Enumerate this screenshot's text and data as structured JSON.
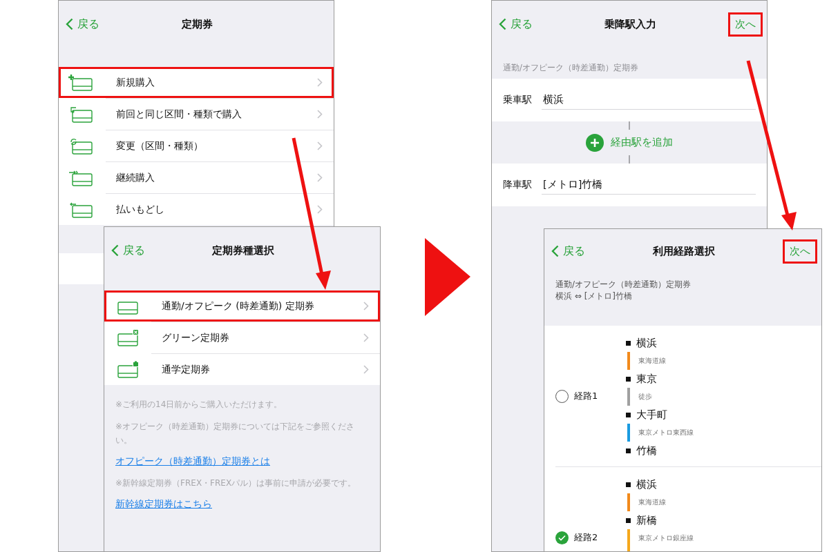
{
  "screen_1": {
    "back": "戻る",
    "title": "定期券",
    "items": [
      {
        "label": "新規購入",
        "highlighted": true
      },
      {
        "label": "前回と同じ区間・種類で購入",
        "highlighted": false
      },
      {
        "label": "変更（区間・種類）",
        "highlighted": false
      },
      {
        "label": "継続購入",
        "highlighted": false
      },
      {
        "label": "払いもどし",
        "highlighted": false
      }
    ]
  },
  "screen_2": {
    "back": "戻る",
    "title": "定期券種選択",
    "items": [
      {
        "label": "通勤/オフピーク (時差通勤) 定期券",
        "highlighted": true
      },
      {
        "label": "グリーン定期券",
        "highlighted": false
      },
      {
        "label": "通学定期券",
        "highlighted": false
      }
    ],
    "notes": [
      {
        "kind": "note",
        "text": "※ご利用の14日前からご購入いただけます。"
      },
      {
        "kind": "note",
        "text": "※オフピーク（時差通勤）定期券については下記をご参照ください。"
      },
      {
        "kind": "link",
        "text": "オフピーク（時差通勤）定期券とは"
      },
      {
        "kind": "note",
        "text": "※新幹線定期券（FREX・FREXパル）は事前に申請が必要です。"
      },
      {
        "kind": "link",
        "text": "新幹線定期券はこちら"
      }
    ]
  },
  "screen_3": {
    "back": "戻る",
    "title": "乗降駅入力",
    "next": {
      "label": "次へ",
      "highlighted": true
    },
    "subtitle": "通勤/オフピーク（時差通勤）定期券",
    "from": {
      "label": "乗車駅",
      "value": "横浜"
    },
    "add_via": "経由駅を追加",
    "to": {
      "label": "降車駅",
      "value": "[メトロ]竹橋"
    }
  },
  "screen_4": {
    "back": "戻る",
    "title": "利用経路選択",
    "next": {
      "label": "次へ",
      "highlighted": true
    },
    "summary": [
      "通勤/オフピーク（時差通勤）定期券",
      "横浜 ⇔ [メトロ]竹橋"
    ],
    "routes": [
      {
        "label": "経路1",
        "selected": false,
        "stations": [
          "横浜",
          "東京",
          "大手町",
          "竹橋"
        ],
        "legs": [
          {
            "line": "東海道線",
            "color": "#f28a1b"
          },
          {
            "line": "徒歩",
            "color": "#a0a0a0"
          },
          {
            "line": "東京メトロ東西線",
            "color": "#1a9be0"
          }
        ]
      },
      {
        "label": "経路2",
        "selected": true,
        "stations": [
          "横浜",
          "新橋"
        ],
        "legs": [
          {
            "line": "東海道線",
            "color": "#f28a1b"
          },
          {
            "line": "東京メトロ銀座線",
            "color": "#f5a81c"
          }
        ]
      }
    ]
  }
}
